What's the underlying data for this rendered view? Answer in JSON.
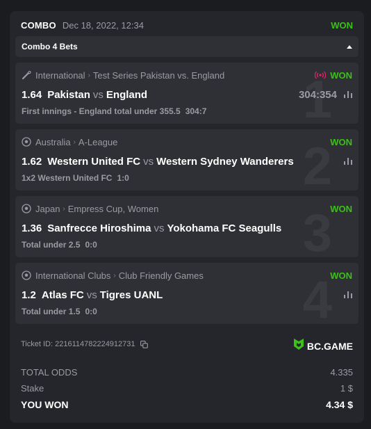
{
  "header": {
    "title": "COMBO",
    "date": "Dec 18, 2022, 12:34",
    "status": "WON"
  },
  "dropdown": {
    "label": "Combo 4 Bets"
  },
  "bets": [
    {
      "number": "1",
      "category": "International",
      "league": "Test Series Pakistan vs. England",
      "sport_icon": "cricket-icon",
      "live": true,
      "status": "WON",
      "odds": "1.64",
      "home": "Pakistan",
      "vs": "vs",
      "away": "England",
      "score": "304:354",
      "market": "First innings - England total under 355.5",
      "result": "304:7"
    },
    {
      "number": "2",
      "category": "Australia",
      "league": "A-League",
      "sport_icon": "soccer-ball-icon",
      "live": false,
      "status": "WON",
      "odds": "1.62",
      "home": "Western United FC",
      "vs": "vs",
      "away": "Western Sydney Wanderers",
      "score": "",
      "market": "1x2 Western United FC",
      "result": "1:0"
    },
    {
      "number": "3",
      "category": "Japan",
      "league": "Empress Cup, Women",
      "sport_icon": "soccer-ball-icon",
      "live": false,
      "status": "WON",
      "odds": "1.36",
      "home": "Sanfrecce Hiroshima",
      "vs": "vs",
      "away": "Yokohama FC Seagulls",
      "score": "",
      "market": "Total under 2.5",
      "result": "0:0"
    },
    {
      "number": "4",
      "category": "International Clubs",
      "league": "Club Friendly Games",
      "sport_icon": "soccer-ball-icon",
      "live": false,
      "status": "WON",
      "odds": "1.2",
      "home": "Atlas FC",
      "vs": "vs",
      "away": "Tigres UANL",
      "score": "",
      "market": "Total under 1.5",
      "result": "0:0"
    }
  ],
  "ticket": {
    "label": "Ticket ID: 2216114782224912731"
  },
  "brand": {
    "name": "BC.GAME"
  },
  "summary": {
    "total_odds_label": "TOTAL ODDS",
    "total_odds": "4.335",
    "stake_label": "Stake",
    "stake": "1 $",
    "won_label": "YOU WON",
    "won": "4.34 $"
  },
  "colors": {
    "won_green": "#3bc117",
    "live_pink": "#e8216b",
    "card_bg": "#24262b",
    "row_bg": "#2e3035"
  }
}
